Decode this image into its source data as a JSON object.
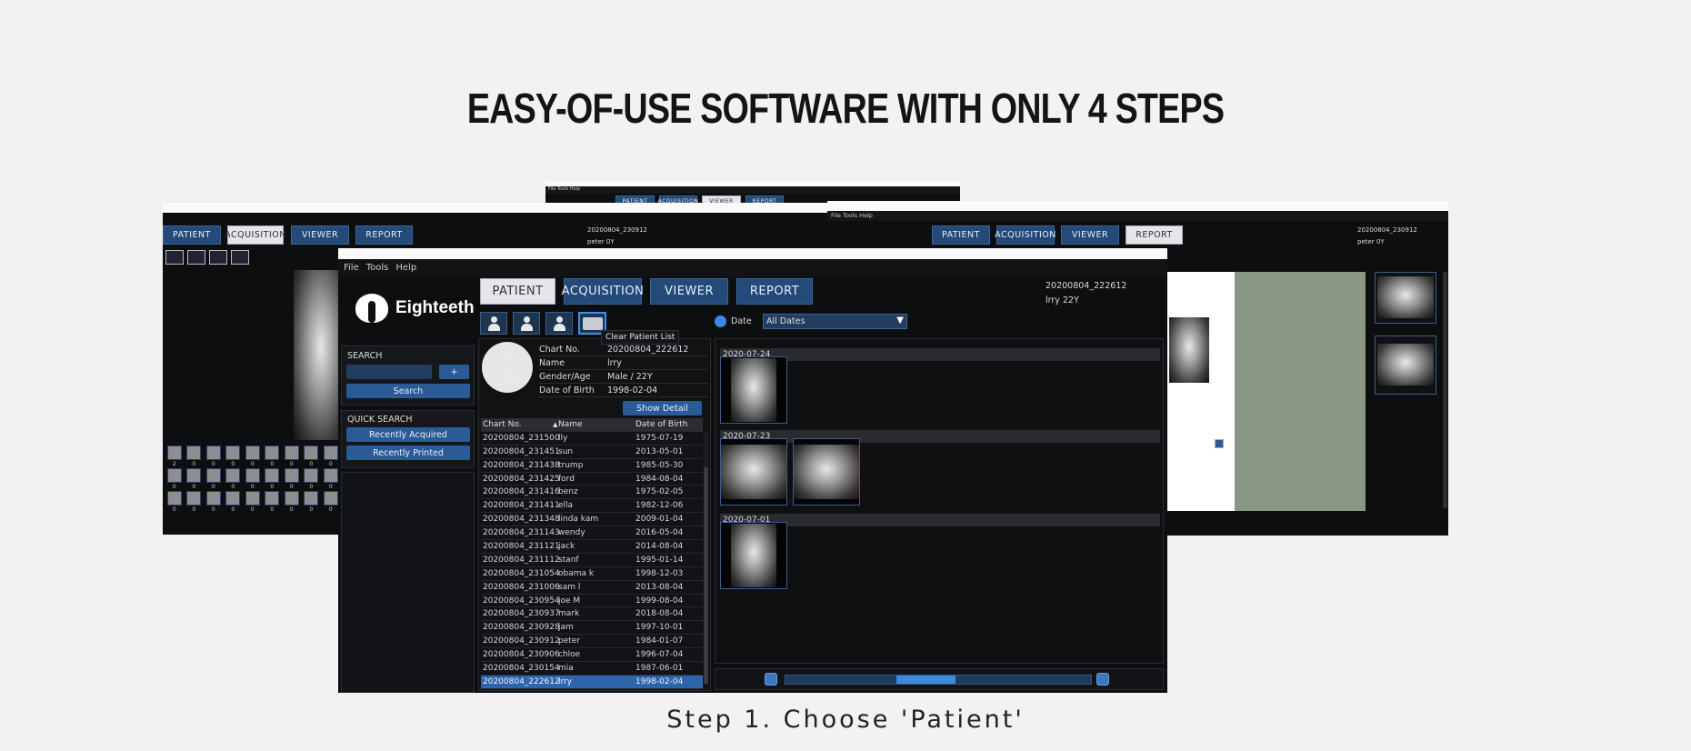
{
  "heading": "EASY-OF-USE SOFTWARE WITH ONLY 4 STEPS",
  "caption": "Step 1. Choose 'Patient'",
  "colors": {
    "tab": "#234a78",
    "tab_active": "#e4e6ea",
    "button": "#2a5b97",
    "selected_row": "#2d64ab",
    "window_bg": "#0d0e10",
    "page_bg": "#f2f2f2"
  },
  "menu": {
    "file": "File",
    "tools": "Tools",
    "help": "Help"
  },
  "tabs": {
    "patient": "PATIENT",
    "acquisition": "ACQUISITION",
    "viewer": "VIEWER",
    "report": "REPORT"
  },
  "main": {
    "logo_text": "Eighteeth",
    "current_chart": "20200804_222612",
    "current_patient": "lrry 22Y",
    "toolbar_icons": [
      "add-patient-icon",
      "edit-patient-icon",
      "delete-patient-icon",
      "clear-patient-list-icon"
    ],
    "tooltip": "Clear Patient List",
    "search": {
      "title": "SEARCH",
      "input_value": "",
      "plus_label": "+",
      "search_label": "Search"
    },
    "quick_search": {
      "title": "QUICK SEARCH",
      "recently_acquired": "Recently Acquired",
      "recently_printed": "Recently Printed"
    },
    "detail": {
      "chart_label": "Chart No.",
      "chart_value": "20200804_222612",
      "name_label": "Name",
      "name_value": "lrry",
      "gender_label": "Gender/Age",
      "gender_value": "Male / 22Y",
      "dob_label": "Date of Birth",
      "dob_value": "1998-02-04",
      "show_detail": "Show Detail"
    },
    "list": {
      "columns": [
        "Chart No.",
        "Name",
        "Date of Birth"
      ],
      "sort_indicator": "▲",
      "rows": [
        [
          "20200804_231500",
          "lly",
          "1975-07-19"
        ],
        [
          "20200804_231451",
          "sun",
          "2013-05-01"
        ],
        [
          "20200804_231438",
          "trump",
          "1985-05-30"
        ],
        [
          "20200804_231425",
          "ford",
          "1984-08-04"
        ],
        [
          "20200804_231416",
          "benz",
          "1975-02-05"
        ],
        [
          "20200804_231411",
          "ella",
          "1982-12-06"
        ],
        [
          "20200804_231348",
          "linda kam",
          "2009-01-04"
        ],
        [
          "20200804_231143",
          "wendy",
          "2016-05-04"
        ],
        [
          "20200804_231121",
          "jack",
          "2014-08-04"
        ],
        [
          "20200804_231112",
          "stanf",
          "1995-01-14"
        ],
        [
          "20200804_231054",
          "obama k",
          "1998-12-03"
        ],
        [
          "20200804_231006",
          "sam l",
          "2013-08-04"
        ],
        [
          "20200804_230954",
          "joe M",
          "1999-08-04"
        ],
        [
          "20200804_230937",
          "mark",
          "2018-08-04"
        ],
        [
          "20200804_230928",
          "jam",
          "1997-10-01"
        ],
        [
          "20200804_230912",
          "peter",
          "1984-01-07"
        ],
        [
          "20200804_230906",
          "chloe",
          "1996-07-04"
        ],
        [
          "20200804_230154",
          "mia",
          "1987-06-01"
        ],
        [
          "20200804_222612",
          "lrry",
          "1998-02-04"
        ]
      ],
      "selected_index": 18
    },
    "filter": {
      "radio_label": "Date",
      "dropdown_value": "All Dates"
    },
    "gallery": [
      {
        "date": "2020-07-24",
        "images": 1
      },
      {
        "date": "2020-07-23",
        "images": 2
      },
      {
        "date": "2020-07-01",
        "images": 1
      }
    ],
    "zoom_slider_fraction": 0.45
  },
  "left_window": {
    "current_chart": "20200804_230912",
    "current_patient": "peter 0Y",
    "tooth_counts": [
      "2",
      "0",
      "0",
      "0",
      "0",
      "0",
      "0",
      "0",
      "0",
      "0",
      "0",
      "0",
      "0",
      "0",
      "0",
      "0",
      "0",
      "0",
      "0",
      "0",
      "0",
      "0",
      "0",
      "0",
      "0",
      "0",
      "0"
    ]
  },
  "right_window": {
    "current_chart": "20200804_230912",
    "current_patient": "peter 0Y"
  }
}
